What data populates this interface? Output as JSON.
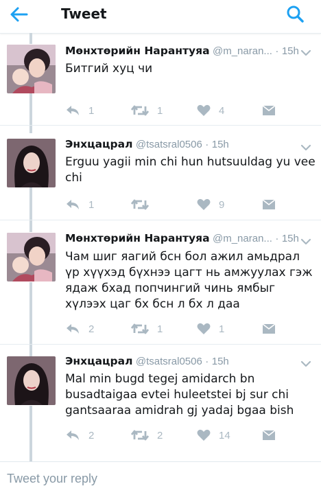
{
  "header": {
    "title": "Tweet",
    "back_icon": "arrow-left-icon",
    "search_icon": "search-icon"
  },
  "colors": {
    "accent": "#1da1f2",
    "icon_gray": "#aab8c2",
    "text_secondary": "#8899a6",
    "thread_line": "#ccd6dd"
  },
  "tweets": [
    {
      "name": "Мөнхтөрийн Нарантуяа",
      "handle": "@m_naran...",
      "time": "15h",
      "text": "Битгий хуц чи",
      "replies": "1",
      "retweets": "1",
      "likes": "4"
    },
    {
      "name": "Энхцацрал",
      "handle": "@tsatsral0506",
      "time": "15h",
      "text": "Erguu yagii min chi hun hutsuuldag yu vee chi",
      "replies": "1",
      "retweets": "",
      "likes": "9"
    },
    {
      "name": "Мөнхтөрийн Нарантуяа",
      "handle": "@m_naran...",
      "time": "15h",
      "text": "Чам шиг яагий бсн бол ажил амьдрал үр хүүхэд бүхнээ цагт нь амжуулах гэж ядаж бхад попчингий чинь ямбыг хүлээх цаг бх бсн л бх л даа",
      "replies": "2",
      "retweets": "1",
      "likes": "1"
    },
    {
      "name": "Энхцацрал",
      "handle": "@tsatsral0506",
      "time": "15h",
      "text": "Mal min bugd tegej amidarch bn busadtaigaa evtei huleetstei bj sur chi gantsaaraa amidrah gj yadaj bgaa bish",
      "replies": "2",
      "retweets": "2",
      "likes": "14"
    }
  ],
  "reply": {
    "placeholder": "Tweet your reply",
    "value": ""
  }
}
